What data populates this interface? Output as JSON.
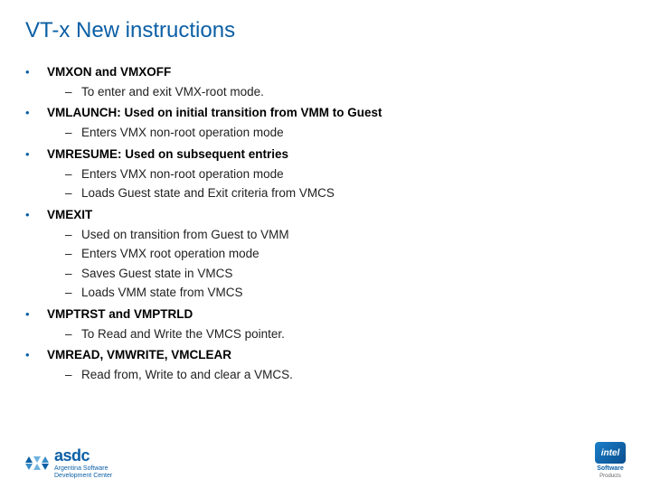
{
  "title": "VT-x New instructions",
  "items": [
    {
      "head": "VMXON and VMXOFF",
      "subs": [
        "To enter and exit VMX-root mode."
      ]
    },
    {
      "head": "VMLAUNCH: Used on initial transition from VMM to Guest",
      "subs": [
        "Enters VMX non-root operation mode"
      ]
    },
    {
      "head": "VMRESUME: Used on subsequent entries",
      "subs": [
        "Enters VMX non-root operation mode",
        "Loads Guest state and Exit criteria from VMCS"
      ]
    },
    {
      "head": "VMEXIT",
      "subs": [
        "Used on transition from Guest to VMM",
        "Enters VMX root operation mode",
        "Saves Guest state in VMCS",
        "Loads VMM state from VMCS"
      ]
    },
    {
      "head": "VMPTRST and VMPTRLD",
      "subs": [
        "To Read and Write the VMCS pointer."
      ]
    },
    {
      "head": "VMREAD, VMWRITE, VMCLEAR",
      "subs": [
        "Read from, Write to and clear a VMCS."
      ]
    }
  ],
  "footer": {
    "asdc_name": "asdc",
    "asdc_line1": "Argentina Software",
    "asdc_line2": "Development Center",
    "intel_name": "intel",
    "intel_sub": "Software",
    "intel_sub2": "Products"
  }
}
